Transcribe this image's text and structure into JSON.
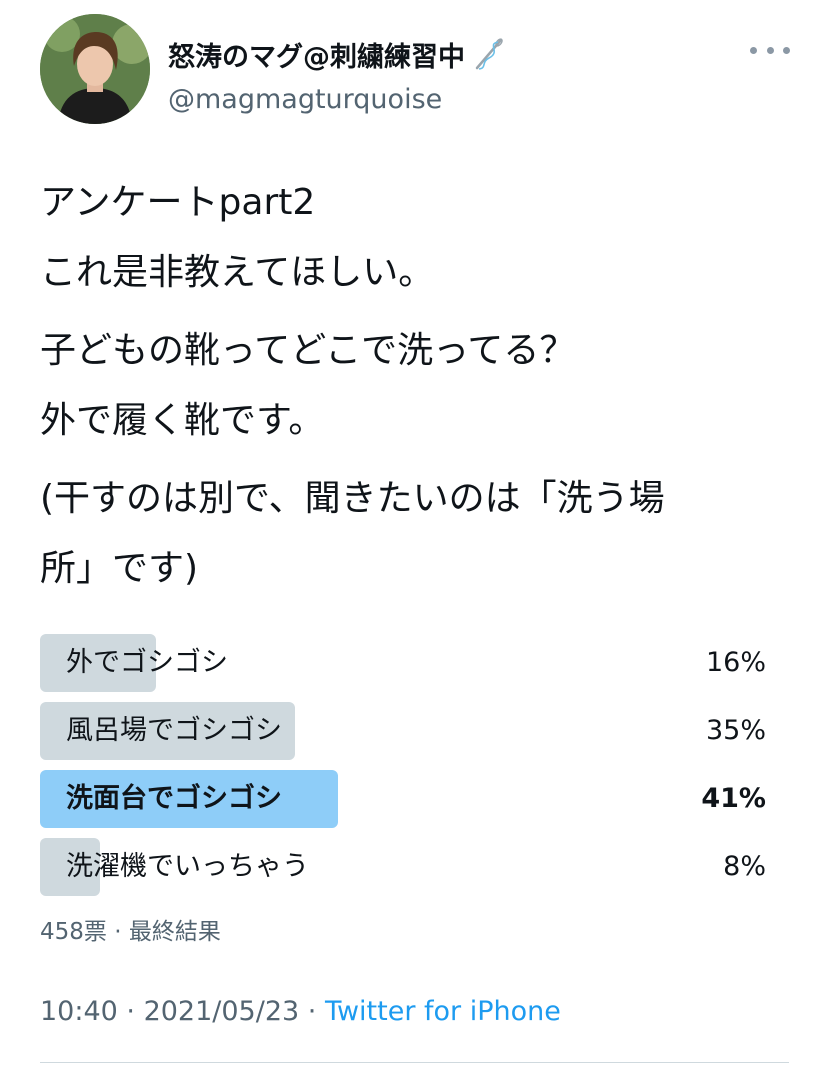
{
  "user": {
    "display_name": "怒涛のマグ@刺繍練習中",
    "handle": "@magmagturquoise",
    "avatar_icon": "profile-photo",
    "name_emoji_icon": "sewing-needle-icon"
  },
  "tweet": {
    "paragraphs": [
      [
        "アンケートpart2",
        "これ是非教えてほしい。"
      ],
      [
        "子どもの靴ってどこで洗ってる？",
        "外で履く靴です。"
      ],
      [
        "(干すのは別で、聞きたいのは「洗う場",
        "所」です)"
      ]
    ]
  },
  "poll": {
    "options": [
      {
        "label": "外でゴシゴシ",
        "percent_label": "16%",
        "percent": 16,
        "winner": false
      },
      {
        "label": "風呂場でゴシゴシ",
        "percent_label": "35%",
        "percent": 35,
        "winner": false
      },
      {
        "label": "洗面台でゴシゴシ",
        "percent_label": "41%",
        "percent": 41,
        "winner": true
      },
      {
        "label": "洗濯機でいっちゃう",
        "percent_label": "8%",
        "percent": 8,
        "winner": false
      }
    ],
    "votes_label": "458票",
    "separator": " · ",
    "status_label": "最終結果"
  },
  "meta": {
    "time": "10:40",
    "date": "2021/05/23",
    "separator": " · ",
    "source": "Twitter for iPhone"
  },
  "colors": {
    "bar_default": "#cfd9de",
    "bar_winner": "#8ecdf8",
    "link": "#1d9bf0",
    "secondary_text": "#536471"
  }
}
